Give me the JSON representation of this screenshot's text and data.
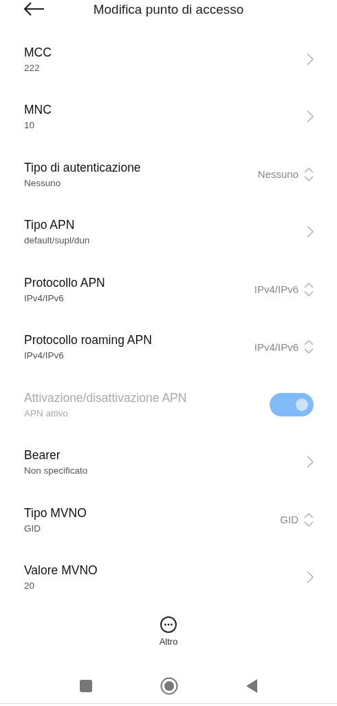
{
  "header": {
    "title": "Modifica punto di accesso"
  },
  "rows": [
    {
      "kind": "link",
      "title": "MCC",
      "subtitle": "222",
      "disabled": false
    },
    {
      "kind": "link",
      "title": "MNC",
      "subtitle": "10",
      "disabled": false
    },
    {
      "kind": "choice",
      "title": "Tipo di autenticazione",
      "subtitle": "Nessuno",
      "value": "Nessuno",
      "disabled": false
    },
    {
      "kind": "link",
      "title": "Tipo APN",
      "subtitle": "default/supl/dun",
      "disabled": false
    },
    {
      "kind": "choice",
      "title": "Protocollo APN",
      "subtitle": "IPv4/IPv6",
      "value": "IPv4/IPv6",
      "disabled": false
    },
    {
      "kind": "choice",
      "title": "Protocollo roaming APN",
      "subtitle": "IPv4/IPv6",
      "value": "IPv4/IPv6",
      "disabled": false
    },
    {
      "kind": "toggle",
      "title": "Attivazione/disattivazione APN",
      "subtitle": "APN attivo",
      "on": true,
      "disabled": true
    },
    {
      "kind": "link",
      "title": "Bearer",
      "subtitle": "Non specificato",
      "disabled": false
    },
    {
      "kind": "choice",
      "title": "Tipo MVNO",
      "subtitle": "GID",
      "value": "GID",
      "disabled": false
    },
    {
      "kind": "link",
      "title": "Valore MVNO",
      "subtitle": "20",
      "disabled": false
    }
  ],
  "more_button": {
    "label": "Altro"
  }
}
